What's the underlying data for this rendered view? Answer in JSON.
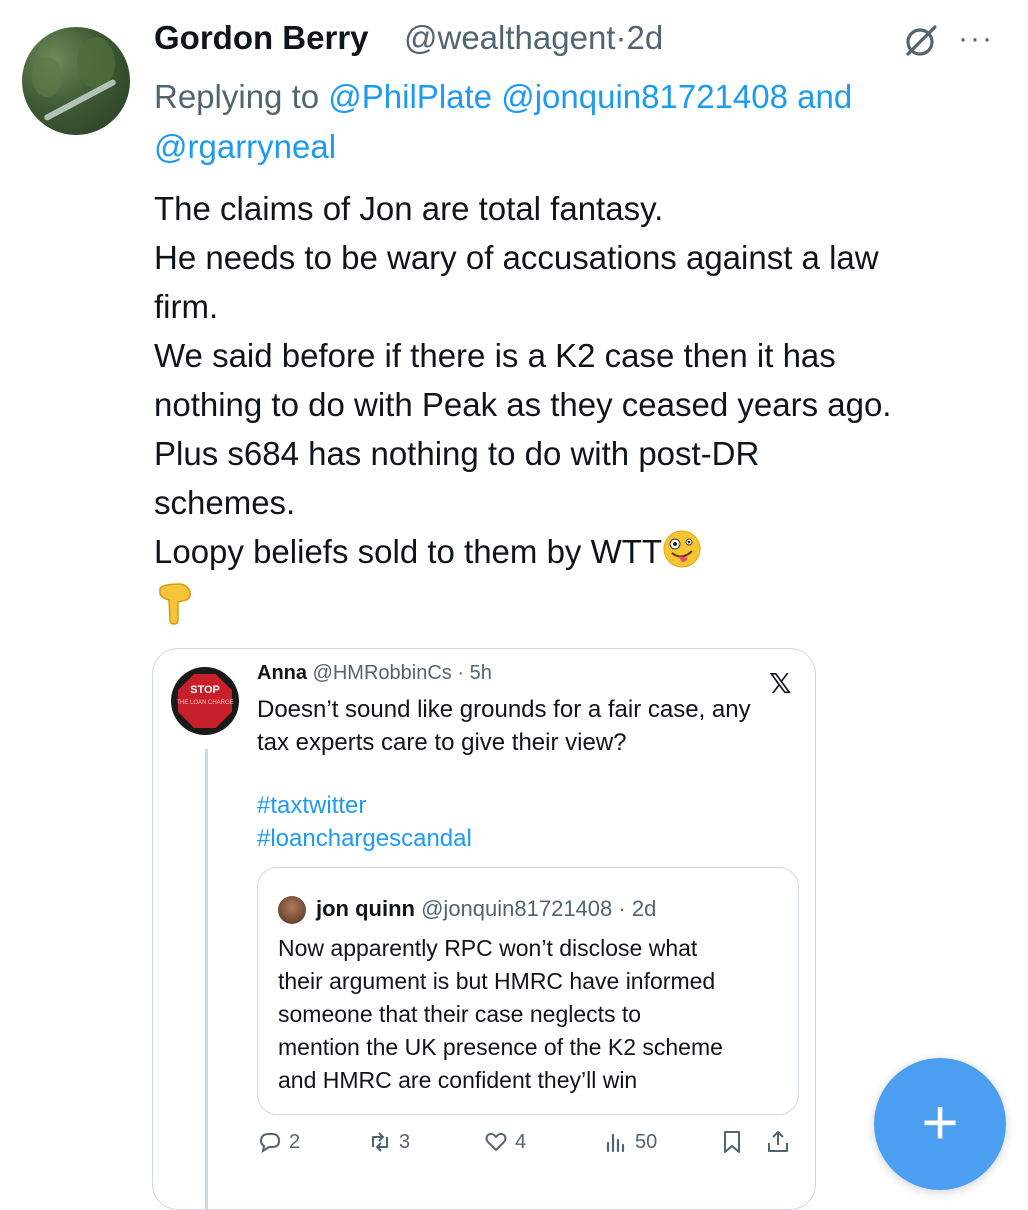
{
  "tweet": {
    "author_name": "Gordon Berry",
    "handle": "@wealthagent",
    "time": "2d",
    "replying_to_prefix": "Replying to",
    "mentions": [
      "@PhilPlate",
      "@jonquin81721408"
    ],
    "and_word": "and",
    "last_mention": "@rgarryneal",
    "body_lines": [
      "The claims of Jon are total fantasy.",
      "He needs to be wary of accusations against a law",
      "firm.",
      "We said before if there is a K2 case then it has",
      "nothing to do with Peak as they ceased years ago.",
      "Plus s684 has nothing to do with post-DR",
      "schemes.",
      "Loopy beliefs sold to them by WTT"
    ],
    "emoji_face": "zany-face-emoji",
    "emoji_point": "backhand-index-pointing-down-emoji"
  },
  "quote": {
    "author_name": "Anna",
    "handle": "@HMRobbinCs",
    "time": "5h",
    "logo_text": "STOP",
    "logo_subtext": "THE LOAN CHARGE",
    "text_lines": [
      "Doesn’t sound like grounds for a fair case, any",
      "tax experts care to give their view?"
    ],
    "hashtags": [
      "#taxtwitter",
      "#loanchargescandal"
    ],
    "inner": {
      "author_name": "jon quinn",
      "handle": "@jonquin81721408",
      "time": "2d",
      "text_lines": [
        "Now apparently RPC won’t disclose what",
        "their argument is but HMRC have informed",
        "someone that their case neglects to",
        "mention the UK presence of the K2 scheme",
        "and HMRC are confident they’ll win"
      ]
    },
    "actions": {
      "replies": "2",
      "reposts": "3",
      "likes": "4",
      "views": "50"
    }
  },
  "colors": {
    "accent": "#1d9bf0",
    "fab": "#4b9ef0",
    "muted": "#536471",
    "text": "#0f1419",
    "border": "#cfd9de"
  }
}
